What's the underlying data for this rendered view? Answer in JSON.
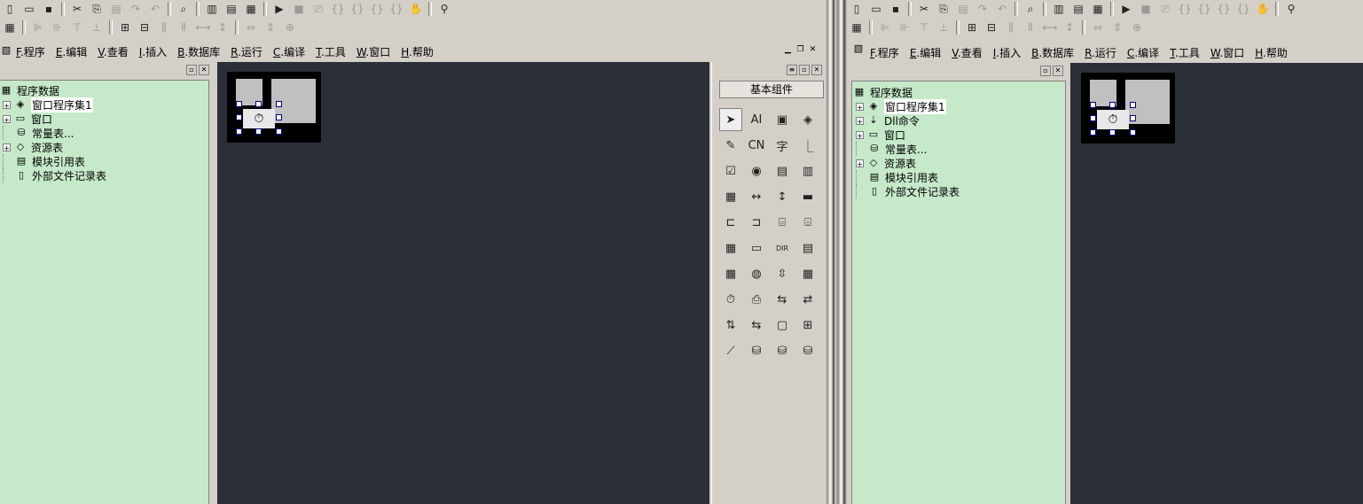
{
  "left": {
    "toolbar1": [
      "new-file-icon",
      "open-folder-icon",
      "save-icon",
      "cut-icon",
      "copy-icon",
      "paste-icon",
      "redo-icon",
      "undo-icon",
      "find-icon",
      "layout1-icon",
      "layout2-icon",
      "layout3-icon",
      "run-icon",
      "stop-icon",
      "step1-icon",
      "step2-icon",
      "step3-icon",
      "step4-icon",
      "step5-icon",
      "hand-icon",
      "help-binoculars-icon"
    ],
    "menu": [
      {
        "key": "F",
        "label": ".程序"
      },
      {
        "key": "E",
        "label": ".编辑"
      },
      {
        "key": "V",
        "label": ".查看"
      },
      {
        "key": "I",
        "label": ".插入"
      },
      {
        "key": "B",
        "label": ".数据库"
      },
      {
        "key": "R",
        "label": ".运行"
      },
      {
        "key": "C",
        "label": ".编译"
      },
      {
        "key": "T",
        "label": ".工具"
      },
      {
        "key": "W",
        "label": ".窗口"
      },
      {
        "key": "H",
        "label": ".帮助"
      }
    ],
    "tree": {
      "root": "程序数据",
      "items": [
        "窗口程序集1",
        "窗口",
        "常量表...",
        "资源表",
        "模块引用表",
        "外部文件记录表"
      ]
    },
    "components_title": "基本组件"
  },
  "right": {
    "menu": [
      {
        "key": "F",
        "label": ".程序"
      },
      {
        "key": "E",
        "label": ".编辑"
      },
      {
        "key": "V",
        "label": ".查看"
      },
      {
        "key": "I",
        "label": ".插入"
      },
      {
        "key": "B",
        "label": ".数据库"
      },
      {
        "key": "R",
        "label": ".运行"
      },
      {
        "key": "C",
        "label": ".编译"
      },
      {
        "key": "T",
        "label": ".工具"
      },
      {
        "key": "W",
        "label": ".窗口"
      },
      {
        "key": "H",
        "label": ".帮助"
      }
    ],
    "tree": {
      "root": "程序数据",
      "items": [
        "窗口程序集1",
        "Dll命令",
        "窗口",
        "常量表...",
        "资源表",
        "模块引用表",
        "外部文件记录表"
      ]
    }
  },
  "components": [
    "pointer",
    "label",
    "picture",
    "shape-fill",
    "edit",
    "button-cn",
    "text-char",
    "frame",
    "checkbox",
    "radio",
    "list1",
    "list2",
    "grid",
    "scroll-h",
    "scroll-v",
    "divider",
    "tab-a",
    "tab-b",
    "tab-c",
    "tab-d",
    "listview",
    "status",
    "dir",
    "doc",
    "calendar",
    "web",
    "updown",
    "datetime",
    "timer",
    "printer",
    "net1",
    "net2",
    "net3",
    "net4",
    "panel",
    "splitter",
    "chart",
    "odbc1",
    "odbc2",
    "odbc-db"
  ],
  "component_glyphs": {
    "pointer": "➤",
    "label": "AI",
    "picture": "▣",
    "shape-fill": "◈",
    "edit": "✎",
    "button-cn": "CN",
    "text-char": "字",
    "frame": "⎿",
    "checkbox": "☑",
    "radio": "◉",
    "list1": "▤",
    "list2": "▥",
    "grid": "▦",
    "scroll-h": "↔",
    "scroll-v": "↕",
    "divider": "▬",
    "tab-a": "⊏",
    "tab-b": "⊐",
    "tab-c": "⌸",
    "tab-d": "⌹",
    "listview": "▦",
    "status": "▭",
    "dir": "DIR",
    "doc": "▤",
    "calendar": "▦",
    "web": "◍",
    "updown": "⇳",
    "datetime": "▦",
    "timer": "⏱",
    "printer": "⎙",
    "net1": "⇆",
    "net2": "⇄",
    "net3": "⇅",
    "net4": "⇆",
    "panel": "▢",
    "splitter": "⊞",
    "chart": "⟋",
    "odbc1": "⛁",
    "odbc2": "⛁",
    "odbc-db": "⛁"
  }
}
